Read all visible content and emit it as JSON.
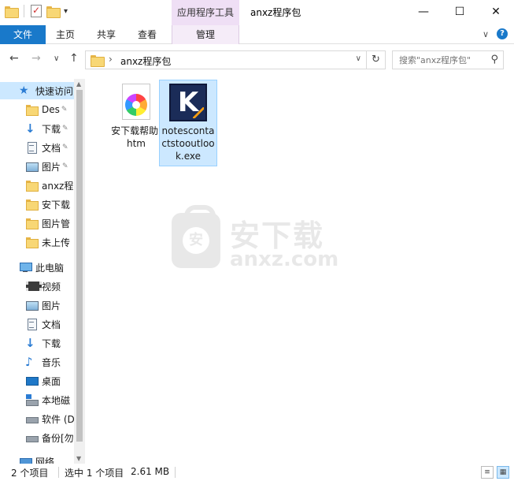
{
  "titlebar": {
    "context_tab": "应用程序工具",
    "window_title": "anxz程序包",
    "minimize": "—",
    "maximize": "☐",
    "close": "✕",
    "qat_dropdown": "▾"
  },
  "ribbon": {
    "file": "文件",
    "home": "主页",
    "share": "共享",
    "view": "查看",
    "manage": "管理",
    "collapse": "∨",
    "help": "?"
  },
  "nav": {
    "back": "←",
    "forward": "→",
    "recent": "∨",
    "up": "↑",
    "address_path": "anxz程序包",
    "address_chevron": "›",
    "address_dropdown": "∨",
    "refresh": "↻",
    "search_placeholder": "搜索\"anxz程序包\"",
    "search_icon": "⚲"
  },
  "sidebar": {
    "quick_access": "快速访问",
    "items": [
      {
        "label": "Des",
        "icon": "folder-icon",
        "pinned": true
      },
      {
        "label": "下载",
        "icon": "download-icon",
        "pinned": true
      },
      {
        "label": "文档",
        "icon": "document-icon",
        "pinned": true
      },
      {
        "label": "图片",
        "icon": "pictures-icon",
        "pinned": true
      },
      {
        "label": "anxz程",
        "icon": "folder-icon",
        "pinned": false
      },
      {
        "label": "安下载",
        "icon": "folder-icon",
        "pinned": false
      },
      {
        "label": "图片管",
        "icon": "folder-icon",
        "pinned": false
      },
      {
        "label": "未上传",
        "icon": "folder-icon",
        "pinned": false
      }
    ],
    "this_pc": "此电脑",
    "pc_items": [
      {
        "label": "视频",
        "icon": "video-icon"
      },
      {
        "label": "图片",
        "icon": "pictures-icon"
      },
      {
        "label": "文档",
        "icon": "document-icon"
      },
      {
        "label": "下载",
        "icon": "download-icon"
      },
      {
        "label": "音乐",
        "icon": "music-icon"
      },
      {
        "label": "桌面",
        "icon": "desktop-icon"
      },
      {
        "label": "本地磁",
        "icon": "local-disk-icon"
      },
      {
        "label": "软件 (D",
        "icon": "drive-icon"
      },
      {
        "label": "备份[勿",
        "icon": "drive-icon"
      }
    ],
    "network": "网络",
    "pin_glyph": "📌",
    "star_glyph": "★",
    "music_glyph": "♪",
    "down_glyph": "🡇",
    "expander": "›"
  },
  "files": [
    {
      "name": "安下载帮助.htm",
      "icon": "htm-file-icon",
      "selected": false
    },
    {
      "name": "notescontactstooutlook.exe",
      "icon": "exe-file-icon",
      "selected": true
    }
  ],
  "exe_icon_letter": "K",
  "watermark": {
    "logo_char": "安",
    "cn": "安下载",
    "en": "anxz.com"
  },
  "status": {
    "item_count": "2 个项目",
    "selected": "选中 1 个项目",
    "size": "2.61 MB",
    "details_view": "≡",
    "icons_view": "▦"
  }
}
